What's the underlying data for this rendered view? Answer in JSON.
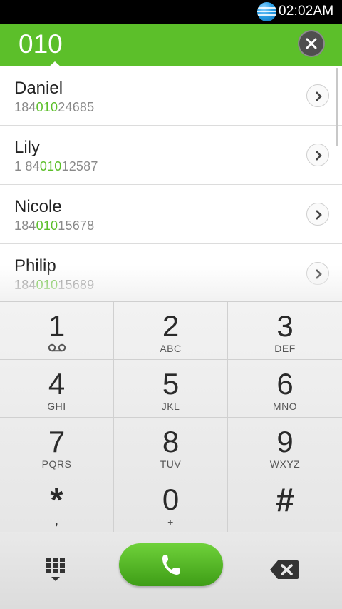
{
  "status_bar": {
    "time": "02:02AM",
    "carrier_icon": "att-globe-icon"
  },
  "dialer": {
    "input": "010",
    "clear_icon": "close-icon"
  },
  "contacts": [
    {
      "name": "Daniel",
      "number_pre": "184",
      "number_match": "010",
      "number_post": "24685"
    },
    {
      "name": "Lily",
      "number_pre": "1 84",
      "number_match": "010",
      "number_post": "12587"
    },
    {
      "name": "Nicole",
      "number_pre": "184",
      "number_match": "010",
      "number_post": "15678"
    },
    {
      "name": "Philip",
      "number_pre": "184",
      "number_match": "010",
      "number_post": "15689"
    }
  ],
  "keypad": {
    "keys": [
      {
        "digit": "1",
        "letters": ""
      },
      {
        "digit": "2",
        "letters": "ABC"
      },
      {
        "digit": "3",
        "letters": "DEF"
      },
      {
        "digit": "4",
        "letters": "GHI"
      },
      {
        "digit": "5",
        "letters": "JKL"
      },
      {
        "digit": "6",
        "letters": "MNO"
      },
      {
        "digit": "7",
        "letters": "PQRS"
      },
      {
        "digit": "8",
        "letters": "TUV"
      },
      {
        "digit": "9",
        "letters": "WXYZ"
      },
      {
        "digit": "*",
        "letters": ","
      },
      {
        "digit": "0",
        "letters": "+"
      },
      {
        "digit": "#",
        "letters": ""
      }
    ]
  },
  "actions": {
    "keypad_toggle_icon": "dialpad-icon",
    "call_icon": "phone-icon",
    "backspace_icon": "backspace-icon"
  },
  "colors": {
    "accent": "#5cbf2a",
    "status_bar": "#000000",
    "call_button": "#4cae1f"
  }
}
